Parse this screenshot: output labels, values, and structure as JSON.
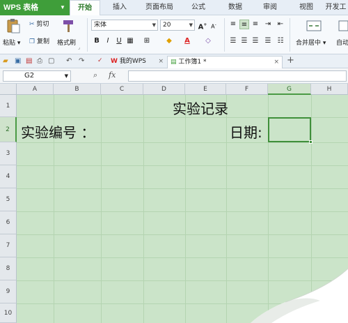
{
  "app": {
    "name": "WPS 表格",
    "menu_tabs": [
      "开始",
      "插入",
      "页面布局",
      "公式",
      "数据",
      "审阅",
      "视图",
      "开发工"
    ],
    "active_tab": "开始"
  },
  "ribbon": {
    "paste_label": "粘贴",
    "cut_label": "剪切",
    "copy_label": "复制",
    "format_painter_label": "格式刷",
    "font_name": "宋体",
    "font_size": "20",
    "merge_center_label": "合并居中",
    "auto_wrap_label": "自动"
  },
  "doc_tabs": [
    {
      "label": "我的WPS"
    },
    {
      "label": "工作簿1 *"
    }
  ],
  "formula_bar": {
    "cell_ref": "G2",
    "fx_label": "fx",
    "content": ""
  },
  "grid": {
    "columns": [
      "A",
      "B",
      "C",
      "D",
      "E",
      "F",
      "G",
      "H"
    ],
    "rows": [
      "1",
      "2",
      "3",
      "4",
      "5",
      "6",
      "7",
      "8",
      "9",
      "10"
    ],
    "selected_column": "G",
    "selected_row": "2"
  },
  "cells": {
    "title": "实验记录",
    "a2": "实验编号 ：",
    "f2": "日期:"
  },
  "colors": {
    "accent": "#3f9e3a",
    "sheet_bg": "#cbe4c9",
    "selection": "#3f8f3a"
  }
}
